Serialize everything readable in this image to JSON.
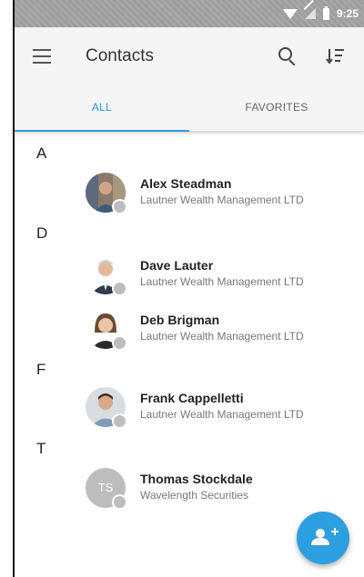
{
  "status_bar": {
    "time": "9:25",
    "icons": [
      "wifi-icon",
      "signal-icon",
      "battery-icon"
    ]
  },
  "app_bar": {
    "title": "Contacts",
    "icons": [
      "menu-icon",
      "search-icon",
      "sort-icon"
    ]
  },
  "tabs": [
    {
      "label": "ALL",
      "active": true
    },
    {
      "label": "FAVORITES",
      "active": false
    }
  ],
  "sections": [
    {
      "letter": "A",
      "contacts": [
        {
          "name": "Alex Steadman",
          "company": "Lautner Wealth Management LTD"
        }
      ]
    },
    {
      "letter": "D",
      "contacts": [
        {
          "name": "Dave Lauter",
          "company": "Lautner Wealth Management LTD"
        },
        {
          "name": "Deb Brigman",
          "company": "Lautner Wealth Management LTD"
        }
      ]
    },
    {
      "letter": "F",
      "contacts": [
        {
          "name": "Frank Cappelletti",
          "company": "Lautner Wealth Management LTD"
        }
      ]
    },
    {
      "letter": "T",
      "contacts": [
        {
          "name": "Thomas Stockdale",
          "company": "Wavelength Securities",
          "initials": "TS"
        }
      ]
    }
  ],
  "fab": {
    "icon": "add-contact-icon"
  },
  "colors": {
    "accent": "#2d9bd8",
    "status_bar": "#9e9e9e",
    "app_bar": "#f5f5f5",
    "presence_offline": "#bdbdbd"
  }
}
